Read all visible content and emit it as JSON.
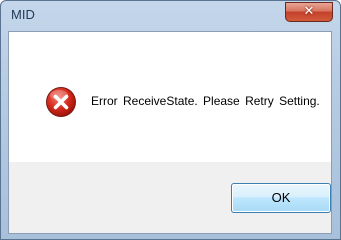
{
  "window": {
    "title": "MID",
    "close_glyph": "✕"
  },
  "dialog": {
    "icon": "error-icon",
    "message": "Error ReceiveState. Please Retry Setting.",
    "ok_label": "OK"
  },
  "colors": {
    "error_red": "#d62a1e",
    "close_button": "#c3412a",
    "ok_border": "#3c7fb1"
  }
}
